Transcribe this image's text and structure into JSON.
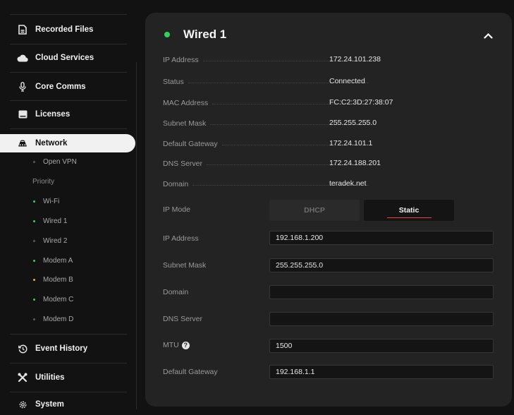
{
  "sidebar": {
    "items": [
      {
        "label": "Recorded Files",
        "icon": "file-icon"
      },
      {
        "label": "Cloud Services",
        "icon": "cloud-icon"
      },
      {
        "label": "Core Comms",
        "icon": "microphone-icon"
      },
      {
        "label": "Licenses",
        "icon": "license-icon"
      },
      {
        "label": "Network",
        "icon": "router-icon"
      }
    ],
    "network_sub": {
      "open_vpn": "Open VPN",
      "priority_label": "Priority",
      "items": [
        {
          "label": "Wi-Fi",
          "status_color": "#2fd35a"
        },
        {
          "label": "Wired 1",
          "status_color": "#2fd35a"
        },
        {
          "label": "Wired 2",
          "status_color": "#5a5a5a"
        },
        {
          "label": "Modem A",
          "status_color": "#2fd35a"
        },
        {
          "label": "Modem B",
          "status_color": "#f2b318"
        },
        {
          "label": "Modem C",
          "status_color": "#2fd35a"
        },
        {
          "label": "Modem D",
          "status_color": "#5a5a5a"
        }
      ]
    },
    "bottom_items": [
      {
        "label": "Event History",
        "icon": "history-icon"
      },
      {
        "label": "Utilities",
        "icon": "tools-icon"
      },
      {
        "label": "System",
        "icon": "gear-icon"
      }
    ]
  },
  "panel": {
    "title": "Wired 1",
    "status_color": "#2fd35a",
    "info": [
      {
        "key": "IP Address",
        "value": "172.24.101.238"
      },
      {
        "key": "Status",
        "value": "Connected"
      },
      {
        "key": "MAC Address",
        "value": "FC:C2:3D:27:38:07"
      },
      {
        "key": "Subnet Mask",
        "value": "255.255.255.0"
      },
      {
        "key": "Default Gateway",
        "value": "172.24.101.1"
      },
      {
        "key": "DNS Server",
        "value": "172.24.188.201"
      },
      {
        "key": "Domain",
        "value": "teradek.net"
      }
    ],
    "ip_mode": {
      "label": "IP Mode",
      "options": [
        "DHCP",
        "Static"
      ],
      "selected": "Static"
    },
    "form": {
      "ip_address": {
        "label": "IP Address",
        "value": "192.168.1.200"
      },
      "subnet_mask": {
        "label": "Subnet Mask",
        "value": "255.255.255.0"
      },
      "domain": {
        "label": "Domain",
        "value": ""
      },
      "dns_server": {
        "label": "DNS Server",
        "value": ""
      },
      "mtu": {
        "label": "MTU",
        "value": "1500"
      },
      "default_gateway": {
        "label": "Default Gateway",
        "value": "192.168.1.1"
      }
    }
  },
  "colors": {
    "accent_underline": "#e2463a",
    "status_green": "#2fd35a",
    "status_amber": "#f2b318"
  }
}
